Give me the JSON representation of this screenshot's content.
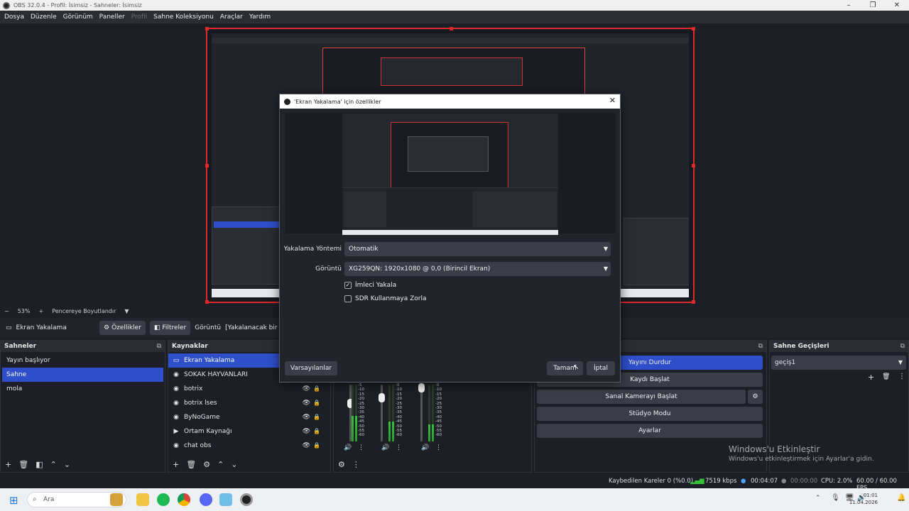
{
  "window": {
    "title": "OBS 32.0.4 - Profil: İsimsiz - Sahneler: İsimsiz"
  },
  "menu": [
    "Dosya",
    "Düzenle",
    "Görünüm",
    "Paneller",
    "Profil",
    "Sahne Koleksiyonu",
    "Araçlar",
    "Yardım"
  ],
  "scale": {
    "zoom": "53%",
    "mode": "Pencereye Boyutlandır"
  },
  "source_toolbar": {
    "source_name": "Ekran Yakalama",
    "properties": "Özellikler",
    "filters": "Filtreler",
    "display_label": "Görüntü",
    "display_value": "[Yakalanacak bir"
  },
  "scenes": {
    "title": "Sahneler",
    "items": [
      {
        "label": "Yayın başlıyor"
      },
      {
        "label": "Sahne"
      },
      {
        "label": "mola"
      }
    ]
  },
  "sources": {
    "title": "Kaynaklar",
    "items": [
      {
        "label": "Ekran Yakalama"
      },
      {
        "label": "SOKAK HAYVANLARI"
      },
      {
        "label": "botrix"
      },
      {
        "label": "botrix lses"
      },
      {
        "label": "ByNoGame"
      },
      {
        "label": "Ortam Kaynağı"
      },
      {
        "label": "chat obs"
      }
    ]
  },
  "mixer": {
    "ticks": [
      "-5",
      "-10",
      "-15",
      "-20",
      "-25",
      "-30",
      "-35",
      "-40",
      "-45",
      "-50",
      "-55",
      "-60"
    ]
  },
  "controls": {
    "stream": "Yayını Durdur",
    "record": "Kaydı Başlat",
    "virtualcam": "Sanal Kamerayı Başlat",
    "studio": "Stüdyo Modu",
    "settings": "Ayarlar"
  },
  "transitions": {
    "title": "Sahne Geçişleri",
    "selected": "geçiş1"
  },
  "dialog": {
    "title": "'Ekran Yakalama' için özellikler",
    "method_label": "Yakalama Yöntemi",
    "method_value": "Otomatik",
    "display_label": "Görüntü",
    "display_value": "XG259QN: 1920x1080 @ 0,0 (Birincil Ekran)",
    "cursor_label": "İmleci Yakala",
    "cursor_checked": true,
    "sdr_label": "SDR Kullanmaya Zorla",
    "sdr_checked": false,
    "defaults": "Varsayılanlar",
    "ok": "Tamam",
    "cancel": "İptal"
  },
  "activate": {
    "title": "Windows'u Etkinleştir",
    "subtitle": "Windows'u etkinleştirmek için Ayarlar'a gidin."
  },
  "status": {
    "dropped": "Kaybedilen Kareler 0 (%0.0)",
    "bitrate": "7519 kbps",
    "stream_time": "00:04:07",
    "rec_time": "00:00:00",
    "cpu": "CPU: 2.0%",
    "fps": "60.00 / 60.00 FPS"
  },
  "taskbar": {
    "search": "Ara",
    "time": "01:01",
    "date": "11.04.2026"
  },
  "colors": {
    "accent": "#2e4fc9",
    "selection_border": "#e02929",
    "meter": "#35c23a"
  }
}
